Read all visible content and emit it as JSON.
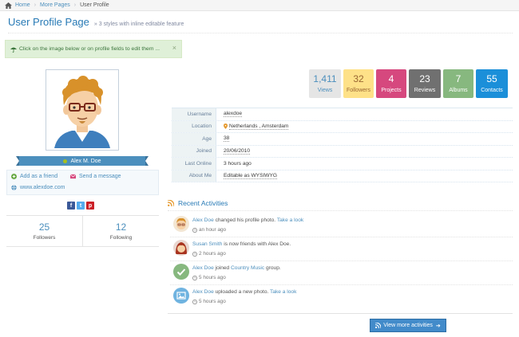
{
  "breadcrumb": {
    "home": "Home",
    "more_pages": "More Pages",
    "current": "User Profile"
  },
  "header": {
    "title": "User Profile Page",
    "subtitle": "3 styles with inline editable feature"
  },
  "alert": {
    "text": "Click on the image below or on profile fields to edit them ...",
    "close": "×"
  },
  "profile": {
    "name": "Alex M. Doe",
    "add_friend": "Add as a friend",
    "send_message": "Send a message",
    "website": "www.alexdoe.com",
    "social": {
      "facebook": "f",
      "twitter": "t",
      "pinterest": "p"
    },
    "followers": {
      "value": "25",
      "label": "Followers"
    },
    "following": {
      "value": "12",
      "label": "Following"
    }
  },
  "stats": [
    {
      "value": "1,411",
      "label": "Views",
      "bg": "#e5e5e5",
      "fg": "#4c8fbd"
    },
    {
      "value": "32",
      "label": "Followers",
      "bg": "#fee188",
      "fg": "#996633"
    },
    {
      "value": "4",
      "label": "Projects",
      "bg": "#d6487e",
      "fg": "#ffffff"
    },
    {
      "value": "23",
      "label": "Reviews",
      "bg": "#707070",
      "fg": "#ffffff"
    },
    {
      "value": "7",
      "label": "Albums",
      "bg": "#87b87f",
      "fg": "#ffffff"
    },
    {
      "value": "55",
      "label": "Contacts",
      "bg": "#1b8fd9",
      "fg": "#ffffff"
    }
  ],
  "info": {
    "username": {
      "label": "Username",
      "value": "alexdoe"
    },
    "location": {
      "label": "Location",
      "value": "Netherlands , Amsterdam"
    },
    "age": {
      "label": "Age",
      "value": "38"
    },
    "joined": {
      "label": "Joined",
      "value": "20/06/2010"
    },
    "last_online": {
      "label": "Last Online",
      "value": "3 hours ago"
    },
    "about": {
      "label": "About Me",
      "value": "Editable as WYSIWYG"
    }
  },
  "activities": {
    "title": "Recent Activities",
    "items": [
      {
        "user": "Alex Doe",
        "text": " changed his profile photo. ",
        "link": "Take a look",
        "time": "an hour ago"
      },
      {
        "user": "Susan Smith",
        "text": " is now friends with Alex Doe.",
        "link": "",
        "time": "2 hours ago"
      },
      {
        "user": "Alex Doe",
        "text": " joined ",
        "link": "Country Music",
        "after": " group.",
        "time": "5 hours ago"
      },
      {
        "user": "Alex Doe",
        "text": " uploaded a new photo. ",
        "link": "Take a look",
        "time": "5 hours ago"
      }
    ],
    "more": "View more activities"
  },
  "colors": {
    "accent": "#4c8fbd",
    "title": "#2679b5",
    "alert_bg": "#dff0d8",
    "ribbon": "#4c8fbd",
    "button": "#428bca"
  }
}
